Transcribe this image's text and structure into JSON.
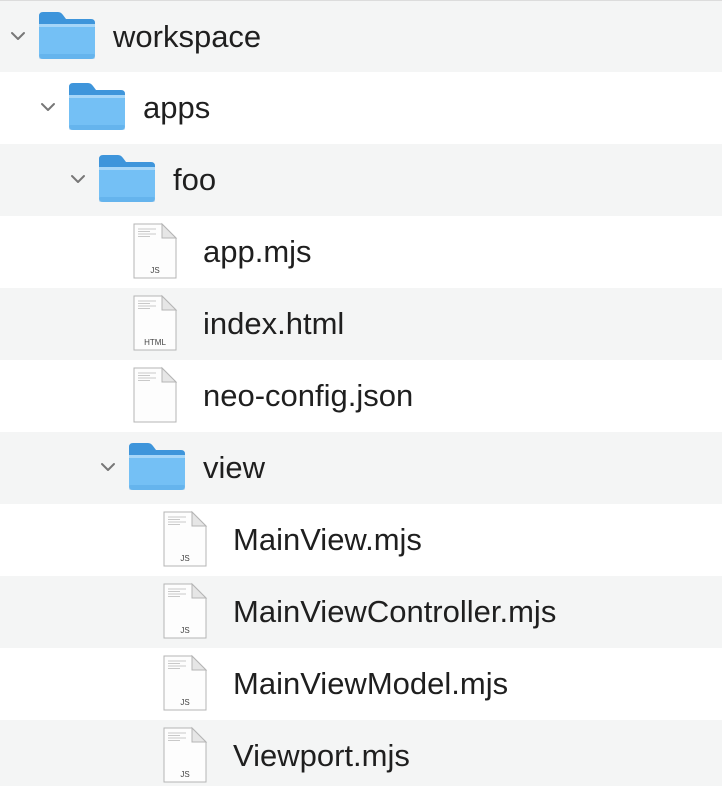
{
  "tree": {
    "rows": [
      {
        "label": "workspace",
        "type": "folder",
        "depth": 0,
        "expanded": true,
        "icon": "folder-icon"
      },
      {
        "label": "apps",
        "type": "folder",
        "depth": 1,
        "expanded": true,
        "icon": "folder-icon"
      },
      {
        "label": "foo",
        "type": "folder",
        "depth": 2,
        "expanded": true,
        "icon": "folder-icon"
      },
      {
        "label": "app.mjs",
        "type": "file",
        "depth": 3,
        "icon": "js-file-icon",
        "badge": "JS"
      },
      {
        "label": "index.html",
        "type": "file",
        "depth": 3,
        "icon": "html-file-icon",
        "badge": "HTML"
      },
      {
        "label": "neo-config.json",
        "type": "file",
        "depth": 3,
        "icon": "json-file-icon",
        "badge": ""
      },
      {
        "label": "view",
        "type": "folder",
        "depth": 3,
        "expanded": true,
        "icon": "folder-icon"
      },
      {
        "label": "MainView.mjs",
        "type": "file",
        "depth": 4,
        "icon": "js-file-icon",
        "badge": "JS"
      },
      {
        "label": "MainViewController.mjs",
        "type": "file",
        "depth": 4,
        "icon": "js-file-icon",
        "badge": "JS"
      },
      {
        "label": "MainViewModel.mjs",
        "type": "file",
        "depth": 4,
        "icon": "js-file-icon",
        "badge": "JS"
      },
      {
        "label": "Viewport.mjs",
        "type": "file",
        "depth": 4,
        "icon": "js-file-icon",
        "badge": "JS"
      }
    ]
  },
  "colors": {
    "folder_body": "#74c0f5",
    "folder_tab": "#3e95db",
    "row_alt": "#f4f5f5",
    "text": "#1f1f1f"
  }
}
